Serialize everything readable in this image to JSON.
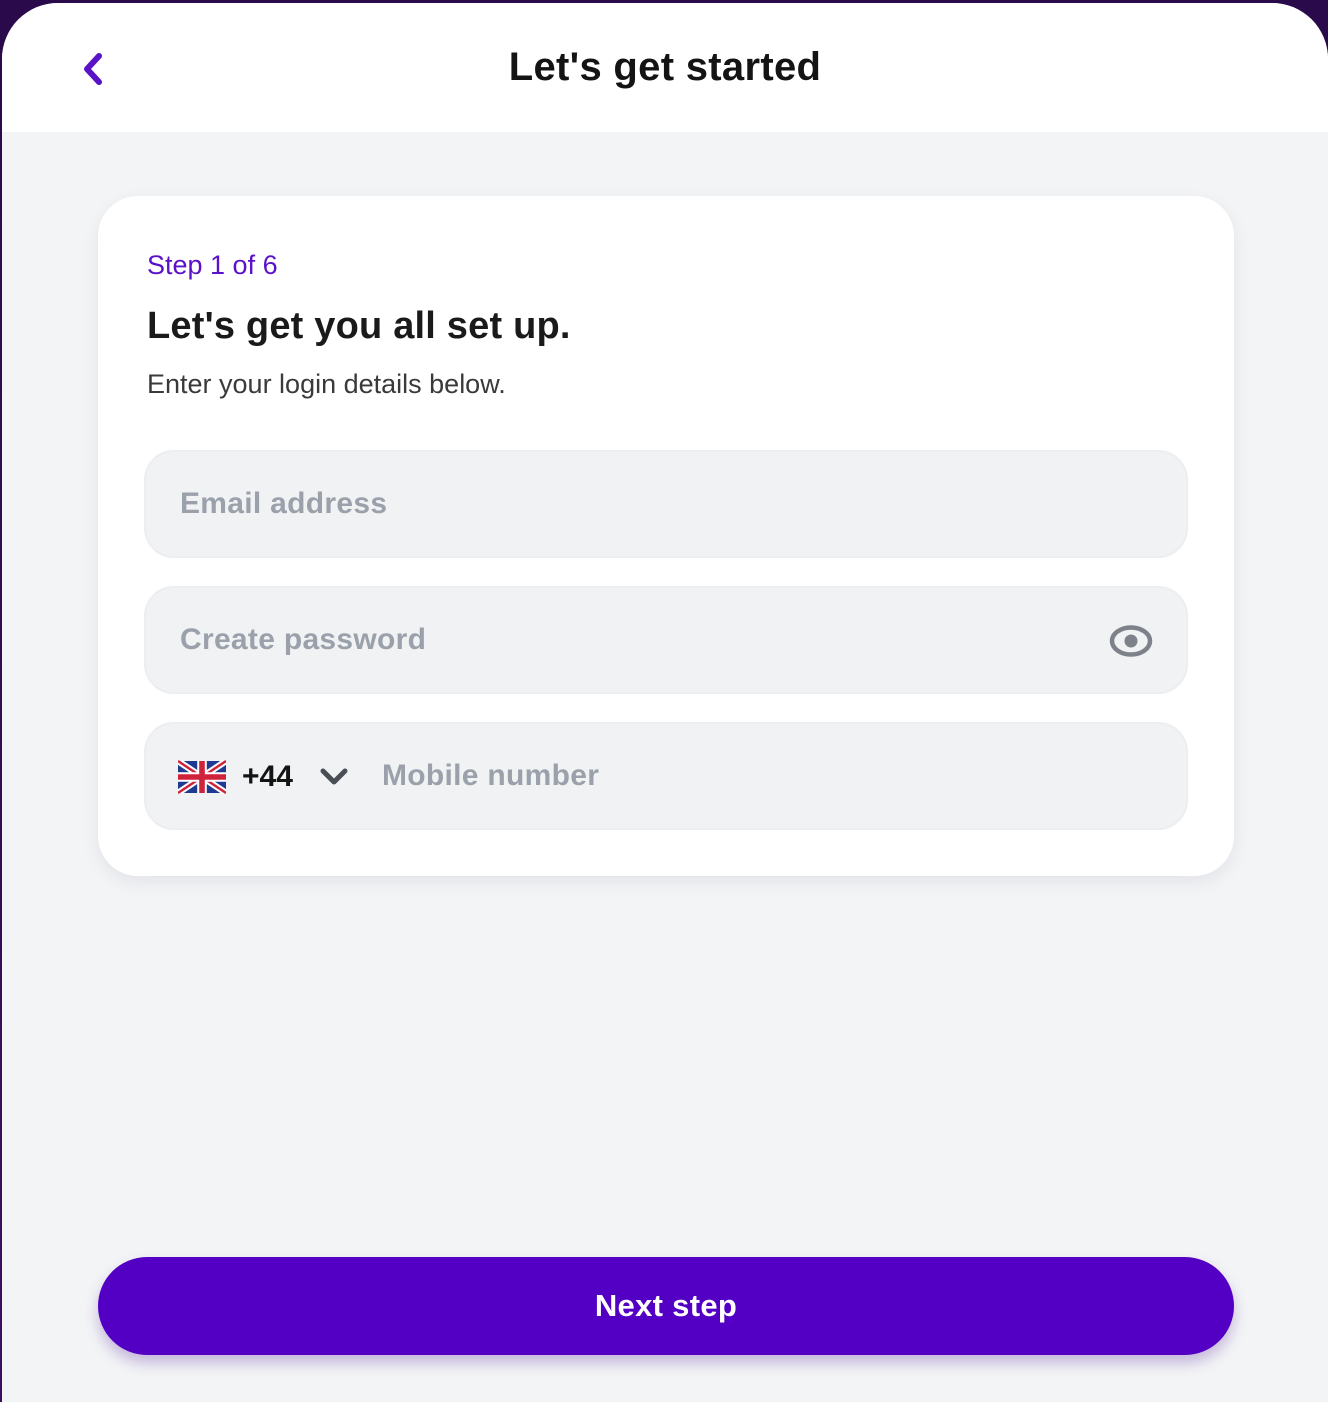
{
  "header": {
    "title": "Let's get started",
    "back_icon": "chevron-left-icon"
  },
  "card": {
    "step_label": "Step 1 of 6",
    "heading": "Let's get you all set up.",
    "subtext": "Enter your login details below.",
    "email": {
      "placeholder": "Email address",
      "value": ""
    },
    "password": {
      "placeholder": "Create password",
      "value": "",
      "toggle_icon": "eye-icon"
    },
    "phone": {
      "country_flag": "uk-flag-icon",
      "dial_code": "+44",
      "dropdown_icon": "chevron-down-icon",
      "placeholder": "Mobile number",
      "value": ""
    }
  },
  "footer": {
    "next_label": "Next step"
  },
  "colors": {
    "accent": "#5300c4",
    "step_text": "#5a12c8",
    "background": "#f3f4f6",
    "field_bg": "#f1f2f4",
    "placeholder": "#9aa1ab"
  }
}
